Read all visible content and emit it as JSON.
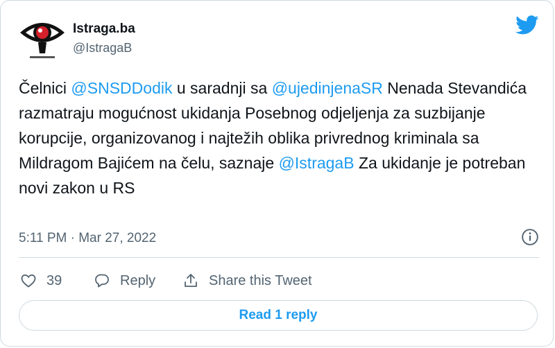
{
  "colors": {
    "accent": "#1d9bf0",
    "muted": "#536471",
    "text": "#0f1419",
    "border": "#cfd9de"
  },
  "author": {
    "name": "Istraga.ba",
    "handle": "@IstragaB",
    "avatar_icon": "eye-logo-icon"
  },
  "tweet": {
    "segments": [
      {
        "text": "Čelnici ",
        "mention": false
      },
      {
        "text": "@SNSDDodik",
        "mention": true
      },
      {
        "text": " u saradnji sa ",
        "mention": false
      },
      {
        "text": "@ujedinjenaSR",
        "mention": true
      },
      {
        "text": " Nenada Stevandića razmatraju mogućnost ukidanja Posebnog odjeljenja za suzbijanje korupcije, organizovanog i najtežih oblika privrednog kriminala sa Mildragom Bajićem na čelu, saznaje ",
        "mention": false
      },
      {
        "text": "@IstragaB",
        "mention": true
      },
      {
        "text": " Za ukidanje je potreban novi zakon u RS",
        "mention": false
      }
    ],
    "timestamp": "5:11 PM · Mar 27, 2022"
  },
  "actions": {
    "like_count": "39",
    "reply_label": "Reply",
    "share_label": "Share this Tweet"
  },
  "read_replies_label": "Read 1 reply",
  "icons": [
    "twitter-bird-icon",
    "info-icon",
    "heart-icon",
    "reply-bubble-icon",
    "share-icon"
  ]
}
